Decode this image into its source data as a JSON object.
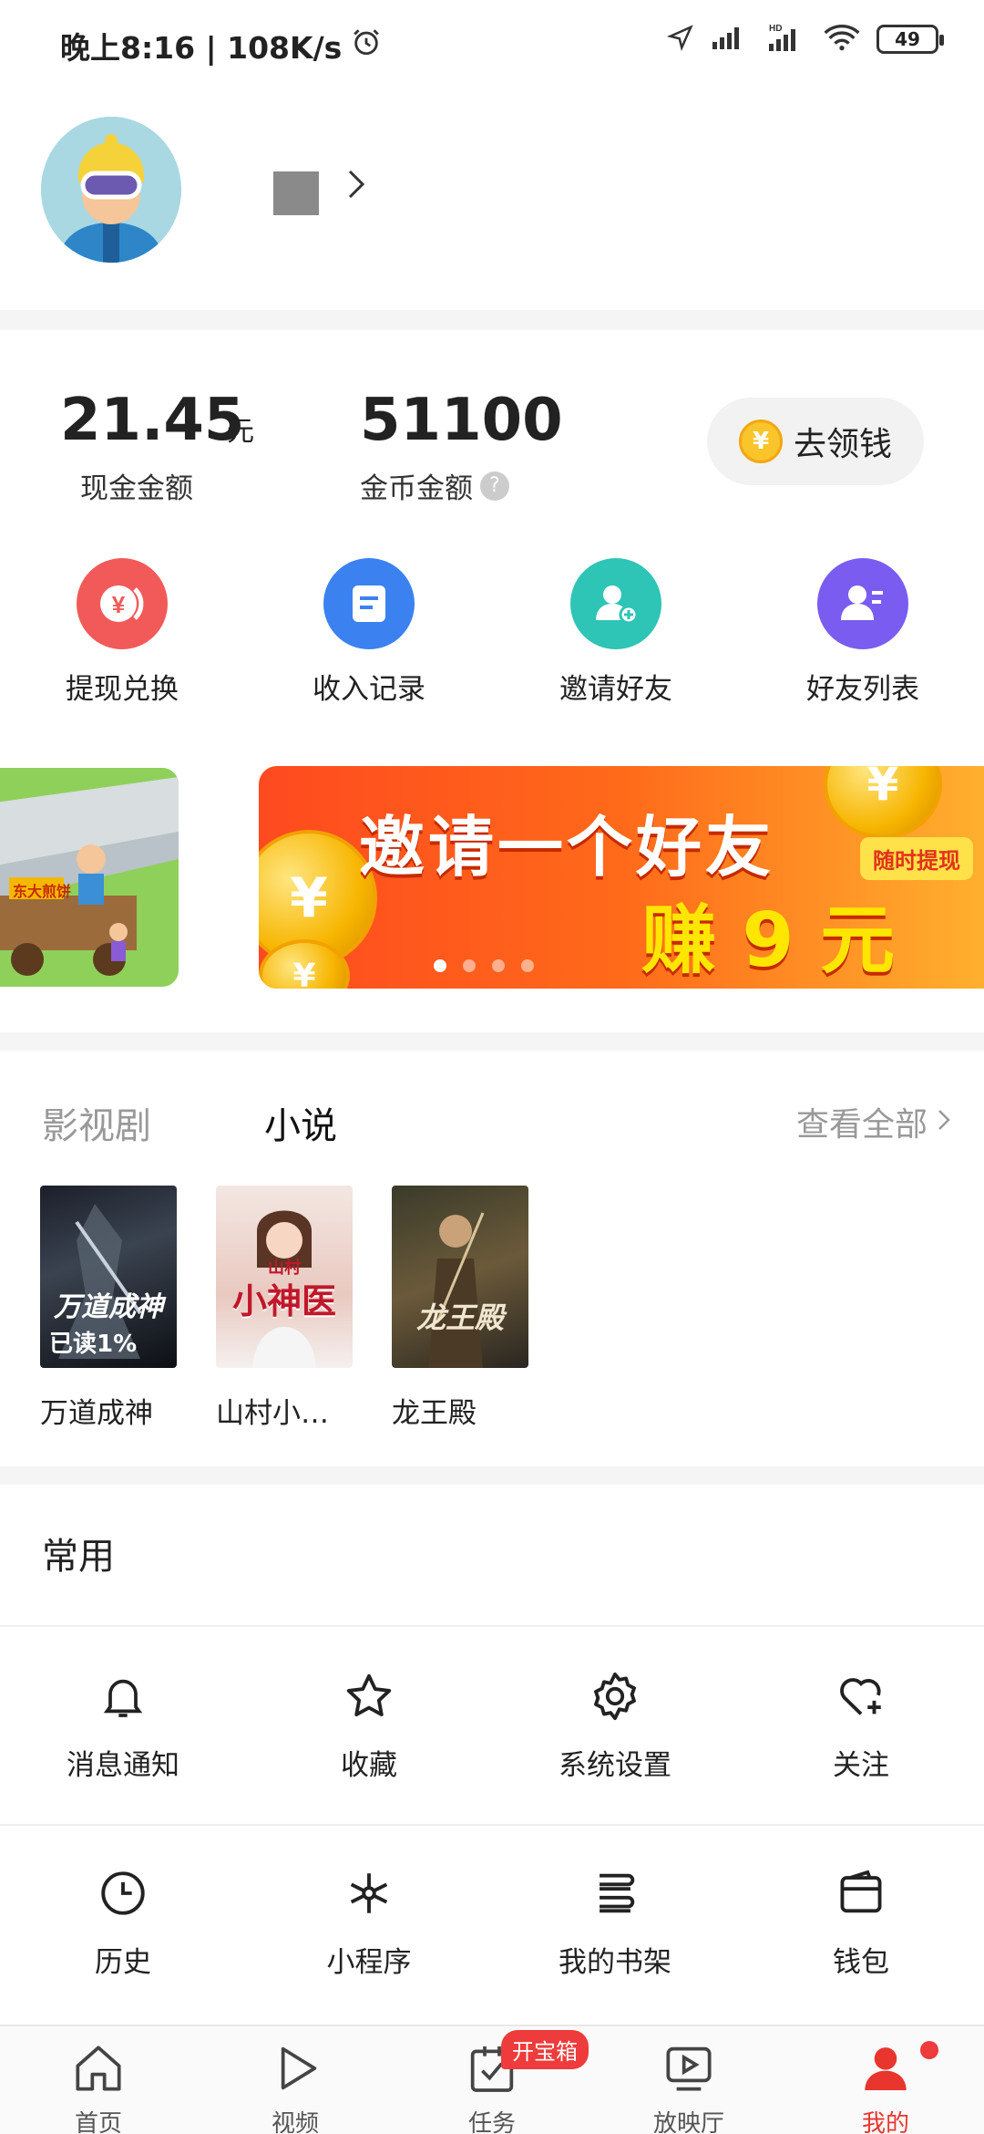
{
  "status_bar": {
    "time": "晚上8:16 | 108K/s",
    "battery": "49"
  },
  "wallet": {
    "cash_value": "21.45",
    "cash_unit": "元",
    "cash_label": "现金金额",
    "coin_value": "51100",
    "coin_label": "金币金额",
    "earn_button": "去领钱"
  },
  "quick_actions": [
    {
      "label": "提现兑换",
      "color": "#f25a5a"
    },
    {
      "label": "收入记录",
      "color": "#3b82f0"
    },
    {
      "label": "邀请好友",
      "color": "#2ec4b6"
    },
    {
      "label": "好友列表",
      "color": "#7b5cf0"
    }
  ],
  "banner": {
    "title": "邀请一个好友",
    "subtitle": "赚 9 元",
    "tag": "随时提现",
    "left_card_sign": "东大煎饼"
  },
  "media": {
    "tab_video": "影视剧",
    "tab_novel": "小说",
    "view_all": "查看全部",
    "books": [
      {
        "title": "万道成神",
        "cover_title": "万道成神",
        "progress": "已读1%"
      },
      {
        "title": "山村小…",
        "cover_title": "小神医",
        "cover_sub": "山村"
      },
      {
        "title": "龙王殿",
        "cover_title": "龙王殿"
      }
    ]
  },
  "common": {
    "title": "常用",
    "items": [
      {
        "label": "消息通知",
        "icon": "bell-icon"
      },
      {
        "label": "收藏",
        "icon": "star-icon"
      },
      {
        "label": "系统设置",
        "icon": "gear-icon"
      },
      {
        "label": "关注",
        "icon": "heart-plus-icon"
      },
      {
        "label": "历史",
        "icon": "clock-icon"
      },
      {
        "label": "小程序",
        "icon": "mini-program-icon"
      },
      {
        "label": "我的书架",
        "icon": "bookshelf-icon"
      },
      {
        "label": "钱包",
        "icon": "wallet-icon"
      }
    ]
  },
  "bottom_nav": {
    "items": [
      {
        "label": "首页"
      },
      {
        "label": "视频"
      },
      {
        "label": "任务"
      },
      {
        "label": "放映厅"
      },
      {
        "label": "我的"
      }
    ],
    "chest_badge": "开宝箱",
    "active_color": "#e8352e"
  }
}
